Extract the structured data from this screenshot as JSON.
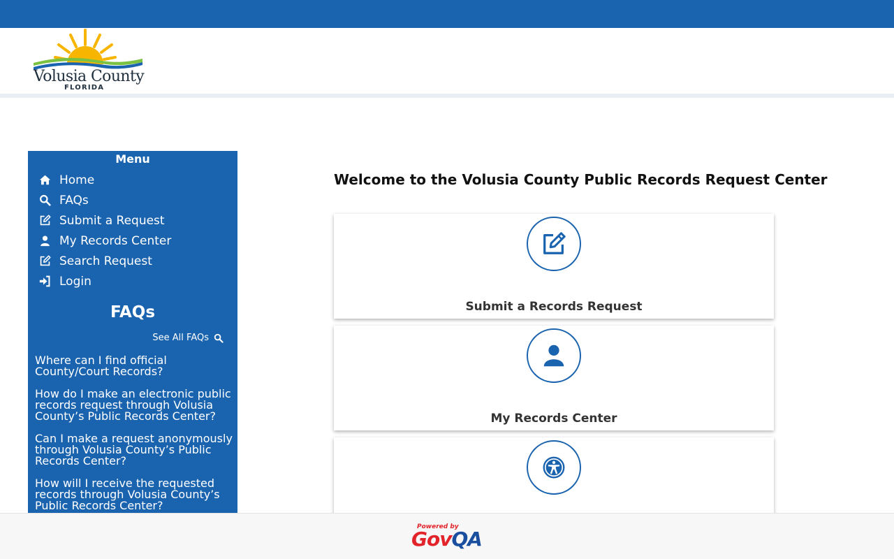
{
  "header": {
    "logo": {
      "name": "Volusia County",
      "state": "FLORIDA"
    }
  },
  "sidebar": {
    "menu_title": "Menu",
    "items": [
      {
        "label": "Home",
        "icon": "home-icon"
      },
      {
        "label": "FAQs",
        "icon": "search-icon"
      },
      {
        "label": "Submit a Request",
        "icon": "edit-icon"
      },
      {
        "label": "My Records Center",
        "icon": "user-icon"
      },
      {
        "label": "Search Request",
        "icon": "edit-icon"
      },
      {
        "label": "Login",
        "icon": "login-icon"
      }
    ],
    "faq_title": "FAQs",
    "see_all_label": "See All FAQs",
    "faqs": [
      "Where can I find official County/Court Records?",
      "How do I make an electronic public records request through Volusia County’s Public Records Center?",
      "Can I make a request anonymously through Volusia County’s Public Records Center?",
      "How will I receive the requested records through Volusia County’s Public Records Center?"
    ]
  },
  "main": {
    "title": "Welcome to the Volusia County Public Records Request Center",
    "cards": [
      {
        "label": "Submit a Records Request",
        "icon": "edit-icon"
      },
      {
        "label": "My Records Center",
        "icon": "user-icon"
      },
      {
        "label": "",
        "icon": "accessibility-icon"
      }
    ]
  },
  "footer": {
    "powered_by": "Powered by",
    "brand_gov": "Gov",
    "brand_qa": "QA"
  },
  "colors": {
    "primary": "#1a63af",
    "footer_bg": "#f7f7f7",
    "brand_red": "#e2232a",
    "brand_blue": "#1a4fa0"
  }
}
